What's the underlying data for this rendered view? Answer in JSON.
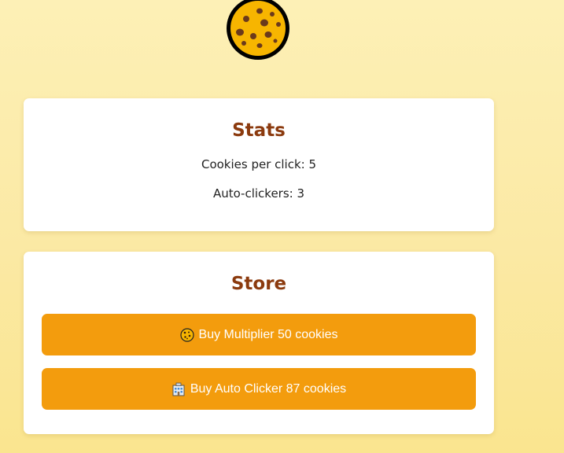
{
  "cookie": {
    "icon": "cookie-icon"
  },
  "stats": {
    "title": "Stats",
    "cookies_per_click": "Cookies per click: 5",
    "auto_clickers": "Auto-clickers: 3"
  },
  "store": {
    "title": "Store",
    "buttons": [
      {
        "icon": "cookie-icon",
        "label": "Buy Multiplier 50 cookies"
      },
      {
        "icon": "factory-icon",
        "label": "Buy Auto Clicker 87 cookies"
      }
    ]
  },
  "colors": {
    "accent": "#f39c0d",
    "title": "#8b3a0e",
    "cookie_fill": "#f7b500",
    "cookie_chips": "#6b3a1c"
  }
}
